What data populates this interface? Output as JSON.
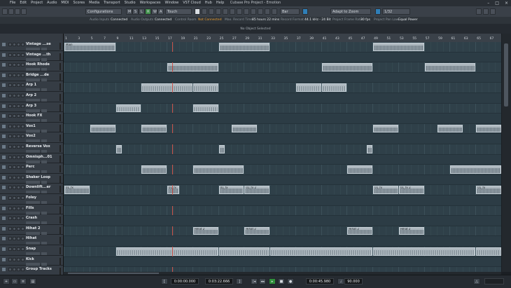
{
  "window": {
    "title": "Cubase Pro Project - Emotion",
    "menu": [
      "File",
      "Edit",
      "Project",
      "Audio",
      "MIDI",
      "Scores",
      "Media",
      "Transport",
      "Studio",
      "Workspaces",
      "Window",
      "VST Cloud",
      "Hub",
      "Help"
    ]
  },
  "toolbar": {
    "configurations": "Configurations",
    "automation_mode": "Touch",
    "snap_mode": "Adapt to Zoom",
    "quantize": "1/32",
    "m_btn": "M",
    "s_btn": "S",
    "l_btn": "L",
    "r_btn": "R",
    "w_btn": "W",
    "a_btn": "A",
    "grid_btn": "Bar"
  },
  "status": {
    "audio_inputs_label": "Audio Inputs",
    "audio_inputs": "Connected",
    "audio_outputs_label": "Audio Outputs",
    "audio_outputs": "Connected",
    "control_room_label": "Control Room",
    "control_room": "Not Connected",
    "max_record_label": "Max. Record Time",
    "max_record": "85 hours 22 mins",
    "record_format_label": "Record Format",
    "record_format": "44.1 kHz - 24 Bit",
    "frame_rate_label": "Project Frame Rate",
    "frame_rate": "30 fps",
    "pan_law_label": "Project Pan Law",
    "pan_law": "Equal Power"
  },
  "selection_message": "No Object Selected",
  "ruler": {
    "bars": [
      "1",
      "3",
      "5",
      "7",
      "9",
      "11",
      "13",
      "15",
      "17",
      "19",
      "21",
      "23",
      "25",
      "27",
      "29",
      "31",
      "33",
      "35",
      "37",
      "39",
      "41",
      "43",
      "45",
      "47",
      "49",
      "51",
      "53",
      "55",
      "57",
      "59",
      "61",
      "63",
      "65",
      "67"
    ]
  },
  "tracks": [
    {
      "name": "Vintage ...se"
    },
    {
      "name": "Vintage ...th"
    },
    {
      "name": "Hook Rhode"
    },
    {
      "name": "Bridge ...de"
    },
    {
      "name": "Arp 1"
    },
    {
      "name": "Arp 2"
    },
    {
      "name": "Arp 3"
    },
    {
      "name": "Hook FX"
    },
    {
      "name": "Vox1"
    },
    {
      "name": "Vox2"
    },
    {
      "name": "Reverse Vox"
    },
    {
      "name": "Omnisph...01"
    },
    {
      "name": "Perc"
    },
    {
      "name": "Shaker Loop"
    },
    {
      "name": "Downlift...er"
    },
    {
      "name": "Foley"
    },
    {
      "name": "Fills"
    },
    {
      "name": "Crash"
    },
    {
      "name": "Hihat 2"
    },
    {
      "name": "Hihat"
    },
    {
      "name": "Snap"
    },
    {
      "name": "Kick"
    },
    {
      "name": "Group Tracks"
    }
  ],
  "event_labels": {
    "main": "Main",
    "arp": "Arp 1",
    "bass": "Bass",
    "shaker": "01_101_Shaker_Ahhh_9000",
    "fx": "01_fx",
    "fx2": "01_fx 2",
    "foley": "Foley",
    "hihat2": "Hihat 2"
  },
  "transport": {
    "left_locator": "0:00:00.000",
    "right_locator": "0:03:22.666",
    "position": "0:00:45.980",
    "tempo": "90.000"
  },
  "colors": {
    "event_fill": "#8d99a3",
    "arrange_bg": "#2f4049",
    "warning": "#f0a030",
    "cursor": "#c9534a"
  }
}
